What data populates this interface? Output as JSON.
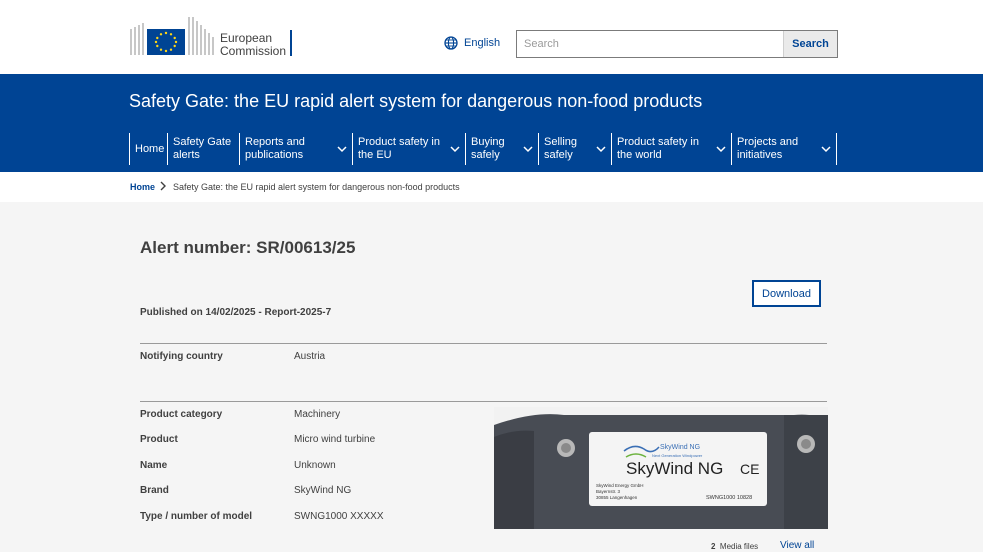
{
  "header": {
    "logo_line1": "European",
    "logo_line2": "Commission",
    "language": "English",
    "search_placeholder": "Search",
    "search_button": "Search"
  },
  "site": {
    "title": "Safety Gate: the EU rapid alert system for dangerous non-food products"
  },
  "nav": {
    "items": [
      {
        "line1": "Home",
        "line2": ""
      },
      {
        "line1": "Safety Gate",
        "line2": "alerts"
      },
      {
        "line1": "Reports and",
        "line2": "publications"
      },
      {
        "line1": "Product safety in",
        "line2": "the EU"
      },
      {
        "line1": "Buying",
        "line2": "safely"
      },
      {
        "line1": "Selling",
        "line2": "safely"
      },
      {
        "line1": "Product safety in",
        "line2": "the world"
      },
      {
        "line1": "Projects and",
        "line2": "initiatives"
      }
    ]
  },
  "breadcrumb": {
    "home": "Home",
    "current": "Safety Gate: the EU rapid alert system for dangerous non-food products"
  },
  "alert": {
    "title": "Alert number: SR/00613/25",
    "download": "Download",
    "published": "Published on 14/02/2025 - Report-2025-7",
    "notifying_label": "Notifying country",
    "notifying_value": "Austria",
    "details": [
      {
        "label": "Product category",
        "value": "Machinery"
      },
      {
        "label": "Product",
        "value": "Micro wind turbine"
      },
      {
        "label": "Name",
        "value": "Unknown"
      },
      {
        "label": "Brand",
        "value": "SkyWind NG"
      },
      {
        "label": "Type / number of model",
        "value": "SWNG1000 XXXXX"
      }
    ]
  },
  "media": {
    "plate_brand_small": "SkyWind NG",
    "plate_tagline": "Next Generation Windpower",
    "plate_brand": "SkyWind NG",
    "plate_ce": "CE",
    "plate_company": "SkyWind Energy GmbH",
    "plate_street": "Bayernstr. 3",
    "plate_city": "30855 Langenhagen",
    "plate_model": "SWNG1000 10828",
    "count": "2",
    "count_label": "Media files",
    "view_all": "View all"
  },
  "colors": {
    "brand_blue": "#004494",
    "eu_yellow": "#ffd617"
  }
}
